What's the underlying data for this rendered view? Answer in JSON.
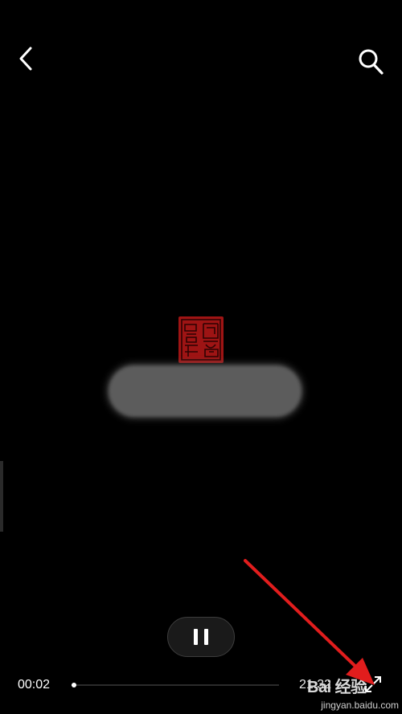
{
  "player": {
    "current_time": "00:02",
    "total_time": "21:32",
    "progress": 0.01
  },
  "icons": {
    "back": "chevron-left-icon",
    "search": "search-icon",
    "pause": "pause-icon",
    "fullscreen": "fullscreen-icon"
  },
  "watermark": {
    "logo": "Bai 经验",
    "url": "jingyan.baidu.com"
  },
  "colors": {
    "background": "#000000",
    "seal": "#9e1414",
    "annotation_arrow": "#e11d1d"
  }
}
